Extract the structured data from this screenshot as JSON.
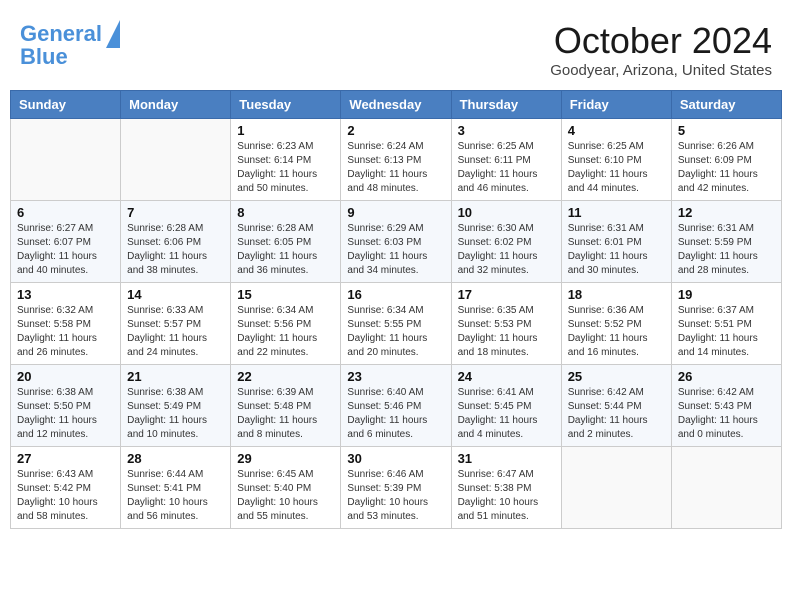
{
  "header": {
    "logo_general": "General",
    "logo_blue": "Blue",
    "month_title": "October 2024",
    "location": "Goodyear, Arizona, United States"
  },
  "days_of_week": [
    "Sunday",
    "Monday",
    "Tuesday",
    "Wednesday",
    "Thursday",
    "Friday",
    "Saturday"
  ],
  "weeks": [
    [
      {
        "day": "",
        "text": ""
      },
      {
        "day": "",
        "text": ""
      },
      {
        "day": "1",
        "text": "Sunrise: 6:23 AM\nSunset: 6:14 PM\nDaylight: 11 hours and 50 minutes."
      },
      {
        "day": "2",
        "text": "Sunrise: 6:24 AM\nSunset: 6:13 PM\nDaylight: 11 hours and 48 minutes."
      },
      {
        "day": "3",
        "text": "Sunrise: 6:25 AM\nSunset: 6:11 PM\nDaylight: 11 hours and 46 minutes."
      },
      {
        "day": "4",
        "text": "Sunrise: 6:25 AM\nSunset: 6:10 PM\nDaylight: 11 hours and 44 minutes."
      },
      {
        "day": "5",
        "text": "Sunrise: 6:26 AM\nSunset: 6:09 PM\nDaylight: 11 hours and 42 minutes."
      }
    ],
    [
      {
        "day": "6",
        "text": "Sunrise: 6:27 AM\nSunset: 6:07 PM\nDaylight: 11 hours and 40 minutes."
      },
      {
        "day": "7",
        "text": "Sunrise: 6:28 AM\nSunset: 6:06 PM\nDaylight: 11 hours and 38 minutes."
      },
      {
        "day": "8",
        "text": "Sunrise: 6:28 AM\nSunset: 6:05 PM\nDaylight: 11 hours and 36 minutes."
      },
      {
        "day": "9",
        "text": "Sunrise: 6:29 AM\nSunset: 6:03 PM\nDaylight: 11 hours and 34 minutes."
      },
      {
        "day": "10",
        "text": "Sunrise: 6:30 AM\nSunset: 6:02 PM\nDaylight: 11 hours and 32 minutes."
      },
      {
        "day": "11",
        "text": "Sunrise: 6:31 AM\nSunset: 6:01 PM\nDaylight: 11 hours and 30 minutes."
      },
      {
        "day": "12",
        "text": "Sunrise: 6:31 AM\nSunset: 5:59 PM\nDaylight: 11 hours and 28 minutes."
      }
    ],
    [
      {
        "day": "13",
        "text": "Sunrise: 6:32 AM\nSunset: 5:58 PM\nDaylight: 11 hours and 26 minutes."
      },
      {
        "day": "14",
        "text": "Sunrise: 6:33 AM\nSunset: 5:57 PM\nDaylight: 11 hours and 24 minutes."
      },
      {
        "day": "15",
        "text": "Sunrise: 6:34 AM\nSunset: 5:56 PM\nDaylight: 11 hours and 22 minutes."
      },
      {
        "day": "16",
        "text": "Sunrise: 6:34 AM\nSunset: 5:55 PM\nDaylight: 11 hours and 20 minutes."
      },
      {
        "day": "17",
        "text": "Sunrise: 6:35 AM\nSunset: 5:53 PM\nDaylight: 11 hours and 18 minutes."
      },
      {
        "day": "18",
        "text": "Sunrise: 6:36 AM\nSunset: 5:52 PM\nDaylight: 11 hours and 16 minutes."
      },
      {
        "day": "19",
        "text": "Sunrise: 6:37 AM\nSunset: 5:51 PM\nDaylight: 11 hours and 14 minutes."
      }
    ],
    [
      {
        "day": "20",
        "text": "Sunrise: 6:38 AM\nSunset: 5:50 PM\nDaylight: 11 hours and 12 minutes."
      },
      {
        "day": "21",
        "text": "Sunrise: 6:38 AM\nSunset: 5:49 PM\nDaylight: 11 hours and 10 minutes."
      },
      {
        "day": "22",
        "text": "Sunrise: 6:39 AM\nSunset: 5:48 PM\nDaylight: 11 hours and 8 minutes."
      },
      {
        "day": "23",
        "text": "Sunrise: 6:40 AM\nSunset: 5:46 PM\nDaylight: 11 hours and 6 minutes."
      },
      {
        "day": "24",
        "text": "Sunrise: 6:41 AM\nSunset: 5:45 PM\nDaylight: 11 hours and 4 minutes."
      },
      {
        "day": "25",
        "text": "Sunrise: 6:42 AM\nSunset: 5:44 PM\nDaylight: 11 hours and 2 minutes."
      },
      {
        "day": "26",
        "text": "Sunrise: 6:42 AM\nSunset: 5:43 PM\nDaylight: 11 hours and 0 minutes."
      }
    ],
    [
      {
        "day": "27",
        "text": "Sunrise: 6:43 AM\nSunset: 5:42 PM\nDaylight: 10 hours and 58 minutes."
      },
      {
        "day": "28",
        "text": "Sunrise: 6:44 AM\nSunset: 5:41 PM\nDaylight: 10 hours and 56 minutes."
      },
      {
        "day": "29",
        "text": "Sunrise: 6:45 AM\nSunset: 5:40 PM\nDaylight: 10 hours and 55 minutes."
      },
      {
        "day": "30",
        "text": "Sunrise: 6:46 AM\nSunset: 5:39 PM\nDaylight: 10 hours and 53 minutes."
      },
      {
        "day": "31",
        "text": "Sunrise: 6:47 AM\nSunset: 5:38 PM\nDaylight: 10 hours and 51 minutes."
      },
      {
        "day": "",
        "text": ""
      },
      {
        "day": "",
        "text": ""
      }
    ]
  ]
}
